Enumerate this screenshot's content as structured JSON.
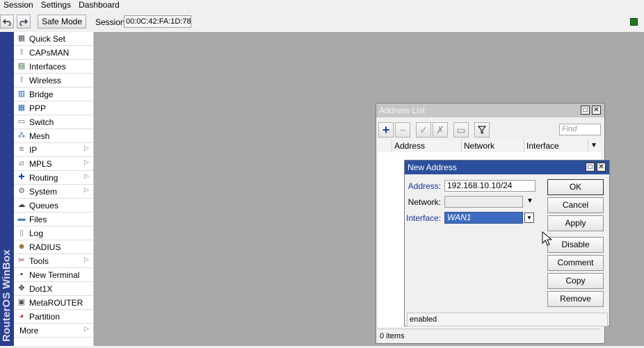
{
  "menubar": {
    "items": [
      "Session",
      "Settings",
      "Dashboard"
    ]
  },
  "toolbar": {
    "undo_icon": "undo-icon",
    "redo_icon": "redo-icon",
    "safe_mode_label": "Safe Mode",
    "session_label": "Session:",
    "session_value": "00:0C:42:FA:1D:78"
  },
  "brand": {
    "text": "RouterOS WinBox"
  },
  "sidebar": {
    "items": [
      {
        "label": "Quick Set",
        "icon": "quick-set-icon",
        "submenu": false
      },
      {
        "label": "CAPsMAN",
        "icon": "capsman-icon",
        "submenu": false
      },
      {
        "label": "Interfaces",
        "icon": "interfaces-icon",
        "submenu": false
      },
      {
        "label": "Wireless",
        "icon": "wireless-icon",
        "submenu": false
      },
      {
        "label": "Bridge",
        "icon": "bridge-icon",
        "submenu": false
      },
      {
        "label": "PPP",
        "icon": "ppp-icon",
        "submenu": false
      },
      {
        "label": "Switch",
        "icon": "switch-icon",
        "submenu": false
      },
      {
        "label": "Mesh",
        "icon": "mesh-icon",
        "submenu": false
      },
      {
        "label": "IP",
        "icon": "ip-icon",
        "submenu": true
      },
      {
        "label": "MPLS",
        "icon": "mpls-icon",
        "submenu": true
      },
      {
        "label": "Routing",
        "icon": "routing-icon",
        "submenu": true
      },
      {
        "label": "System",
        "icon": "system-icon",
        "submenu": true
      },
      {
        "label": "Queues",
        "icon": "queues-icon",
        "submenu": false
      },
      {
        "label": "Files",
        "icon": "files-icon",
        "submenu": false
      },
      {
        "label": "Log",
        "icon": "log-icon",
        "submenu": false
      },
      {
        "label": "RADIUS",
        "icon": "radius-icon",
        "submenu": false
      },
      {
        "label": "Tools",
        "icon": "tools-icon",
        "submenu": true
      },
      {
        "label": "New Terminal",
        "icon": "terminal-icon",
        "submenu": false
      },
      {
        "label": "Dot1X",
        "icon": "dot1x-icon",
        "submenu": false
      },
      {
        "label": "MetaROUTER",
        "icon": "metarouter-icon",
        "submenu": false
      },
      {
        "label": "Partition",
        "icon": "partition-icon",
        "submenu": false
      },
      {
        "label": "More",
        "icon": "",
        "submenu": true
      }
    ]
  },
  "address_list": {
    "title": "Address List",
    "find_placeholder": "Find",
    "columns": [
      "Address",
      "Network",
      "Interface"
    ],
    "status": "0 items"
  },
  "new_address": {
    "title": "New Address",
    "address_label": "Address:",
    "address_value": "192.168.10.10/24",
    "network_label": "Network:",
    "network_value": "",
    "interface_label": "Interface:",
    "interface_value": "WAN1",
    "buttons": {
      "ok": "OK",
      "cancel": "Cancel",
      "apply": "Apply",
      "disable": "Disable",
      "comment": "Comment",
      "copy": "Copy",
      "remove": "Remove"
    },
    "status": "enabled"
  },
  "colors": {
    "brand_strip": "#2b3f8f",
    "active_title": "#2b4f9c",
    "inactive_title": "#c6c6c6",
    "workarea": "#a9a9a9",
    "status_led": "#1e7a1e"
  }
}
